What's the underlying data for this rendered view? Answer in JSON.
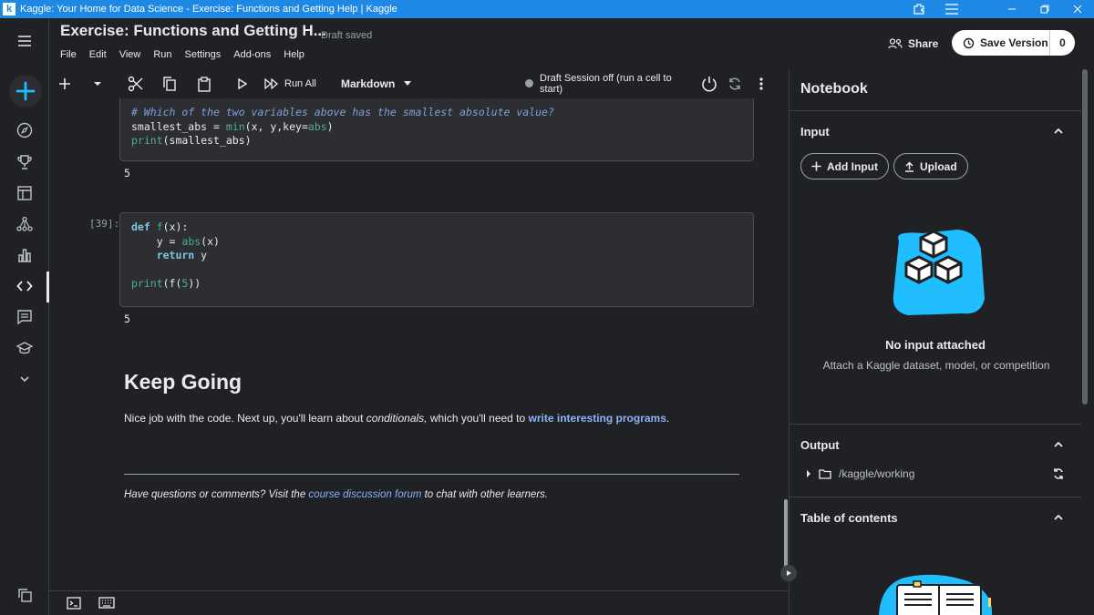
{
  "window": {
    "logo_letter": "k",
    "title": "Kaggle: Your Home for Data Science - Exercise: Functions and Getting Help | Kaggle"
  },
  "header": {
    "notebook_title": "Exercise: Functions and Getting H...",
    "draft_status": "Draft saved",
    "menu": [
      "File",
      "Edit",
      "View",
      "Run",
      "Settings",
      "Add-ons",
      "Help"
    ],
    "share_label": "Share",
    "save_version_label": "Save Version",
    "save_version_count": "0"
  },
  "toolbar": {
    "run_all_label": "Run All",
    "cell_type": "Markdown",
    "session_status": "Draft Session off (run a cell to start)"
  },
  "cells": {
    "cell1": {
      "lines": [
        {
          "parts": [
            {
              "t": "# Which of the two variables above has the smallest absolute value?",
              "c": "cm"
            }
          ]
        },
        {
          "parts": [
            {
              "t": "smallest_abs = ",
              "c": ""
            },
            {
              "t": "min",
              "c": "bi"
            },
            {
              "t": "(x, y,key=",
              "c": ""
            },
            {
              "t": "abs",
              "c": "bi"
            },
            {
              "t": ")",
              "c": ""
            }
          ]
        },
        {
          "parts": [
            {
              "t": "print",
              "c": "bi"
            },
            {
              "t": "(smallest_abs)",
              "c": ""
            }
          ]
        }
      ],
      "output": "5"
    },
    "cell2": {
      "prompt": "[39]:",
      "lines": [
        {
          "parts": [
            {
              "t": "def ",
              "c": "kw"
            },
            {
              "t": "f",
              "c": "fn"
            },
            {
              "t": "(x):",
              "c": ""
            }
          ]
        },
        {
          "parts": [
            {
              "t": "    y = ",
              "c": ""
            },
            {
              "t": "abs",
              "c": "bi"
            },
            {
              "t": "(x)",
              "c": ""
            }
          ]
        },
        {
          "parts": [
            {
              "t": "    return ",
              "c": "kw"
            },
            {
              "t": "y",
              "c": ""
            }
          ]
        },
        {
          "parts": [
            {
              "t": "",
              "c": ""
            }
          ]
        },
        {
          "parts": [
            {
              "t": "print",
              "c": "bi"
            },
            {
              "t": "(f(",
              "c": ""
            },
            {
              "t": "5",
              "c": "num"
            },
            {
              "t": "))",
              "c": ""
            }
          ]
        }
      ],
      "output": "5"
    }
  },
  "markdown": {
    "heading": "Keep Going",
    "para_before": "Nice job with the code. Next up, you'll learn about ",
    "para_italic": "conditionals,",
    "para_mid": " which you'll need to ",
    "para_link": "write interesting programs",
    "para_after": ".",
    "question_before": "Have questions or comments? Visit the ",
    "question_link": "course discussion forum",
    "question_after": " to chat with other learners."
  },
  "right_panel": {
    "title": "Notebook",
    "input_heading": "Input",
    "add_input_label": "Add Input",
    "upload_label": "Upload",
    "no_input_title": "No input attached",
    "no_input_sub": "Attach a Kaggle dataset, model, or competition",
    "output_heading": "Output",
    "output_path": "/kaggle/working",
    "toc_heading": "Table of contents"
  },
  "colors": {
    "accent": "#1e88e5",
    "illustration": "#20beff",
    "link": "#8ab4f8"
  }
}
